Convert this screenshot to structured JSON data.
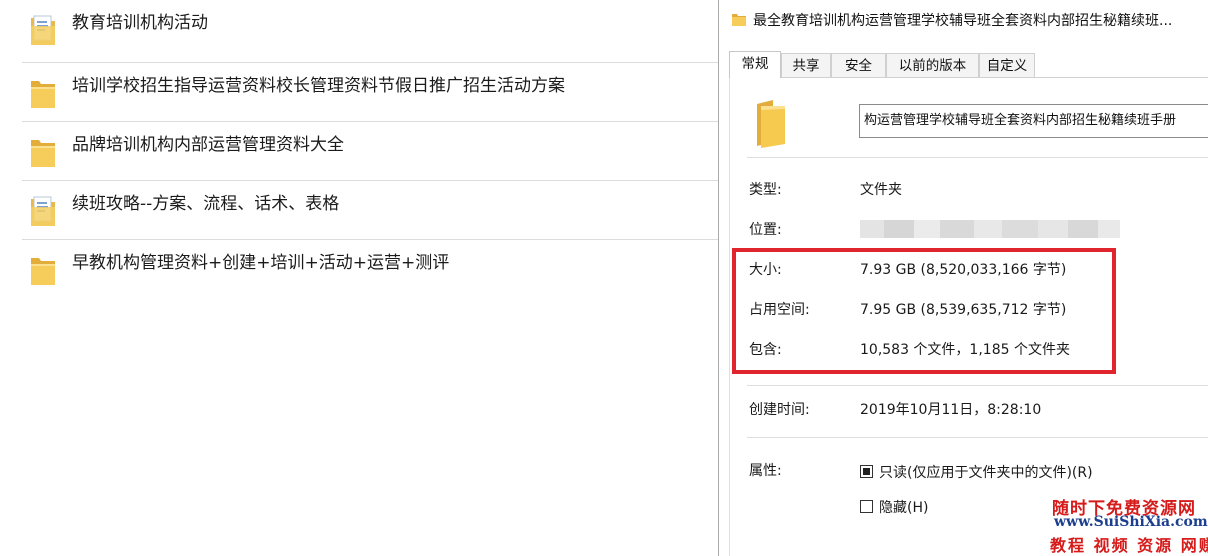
{
  "file_list": {
    "items": [
      {
        "name": "教育培训机构活动",
        "icon": "document-folder-icon"
      },
      {
        "name": "培训学校招生指导运营资料校长管理资料节假日推广招生活动方案",
        "icon": "folder-icon"
      },
      {
        "name": "品牌培训机构内部运营管理资料大全",
        "icon": "folder-icon"
      },
      {
        "name": "续班攻略--方案、流程、话术、表格",
        "icon": "document-folder-icon"
      },
      {
        "name": "早教机构管理资料+创建+培训+活动+运营+测评",
        "icon": "folder-icon"
      }
    ]
  },
  "dialog": {
    "title": "最全教育培训机构运营管理学校辅导班全套资料内部招生秘籍续班...",
    "tabs": [
      {
        "label": "常规",
        "active": true
      },
      {
        "label": "共享",
        "active": false
      },
      {
        "label": "安全",
        "active": false
      },
      {
        "label": "以前的版本",
        "active": false
      },
      {
        "label": "自定义",
        "active": false
      }
    ],
    "folder_name": "构运营管理学校辅导班全套资料内部招生秘籍续班手册",
    "type_label": "类型:",
    "type_value": "文件夹",
    "location_label": "位置:",
    "size_label": "大小:",
    "size_value": "7.93 GB (8,520,033,166 字节)",
    "disk_label": "占用空间:",
    "disk_value": "7.95 GB (8,539,635,712 字节)",
    "contains_label": "包含:",
    "contains_value": "10,583 个文件，1,185 个文件夹",
    "created_label": "创建时间:",
    "created_value": "2019年10月11日，8:28:10",
    "attributes_label": "属性:",
    "readonly_label": "只读(仅应用于文件夹中的文件)(R)",
    "readonly_checked": true,
    "hidden_label": "隐藏(H)",
    "hidden_checked": false
  },
  "watermark": {
    "line1": "随时下免费资源网",
    "line2": "www.SuiShiXia.com",
    "line3": "教程 视频 资源 网赚"
  },
  "colors": {
    "folder": "#f4c74e",
    "highlight_box": "#e1252f",
    "watermark_red": "#d61b1b",
    "watermark_blue": "#1b3e8e"
  }
}
